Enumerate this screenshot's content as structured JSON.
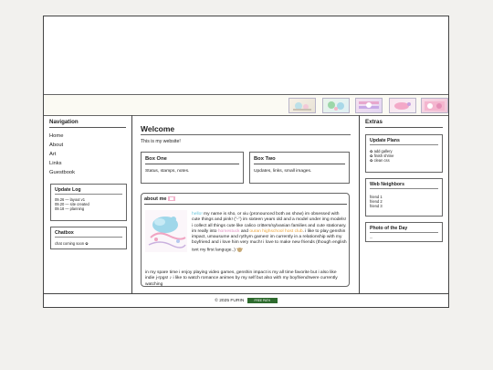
{
  "nav": {
    "title": "Navigation",
    "items": [
      "Home",
      "About",
      "Art",
      "Links",
      "Guestbook"
    ]
  },
  "update_log": {
    "title": "Update Log",
    "entries": [
      "09.26 — layout v1",
      "09.20 — site created",
      "09.18 — planning"
    ]
  },
  "chatbox": {
    "title": "Chatbox",
    "text": "chat coming soon ✿"
  },
  "main": {
    "title": "Welcome",
    "intro": "This is my website!",
    "box_one": {
      "title": "Box One",
      "body": "Status, stamps, notes."
    },
    "box_two": {
      "title": "Box Two",
      "body": "Updates, links, small images."
    }
  },
  "about": {
    "title": "about me",
    "hello": "hello!",
    "p1": " my name is sho, or xiu (pronounced both as show) im obsessed with cute things and pink! (˘ᵕ˘) im sixteen years old and a model under img models! i collect all things cute like calico critters/sylvanian families and cute stationary. im really into ",
    "tag1": "homestuck",
    "mid1": " and ",
    "tag2": "ouran highschool host club",
    "p1b": ". i like to play genshin impact, umausume and rythym games! im currently in a relationship with my boyfriend and i love him very much! i love to make new friends (though english isnt my first languge..)",
    "p2": "in my spare time i enjoy playing video games, genshin impact is my all time favorite but i also like indie j-rpgs! ♪ i like to watch romance animes by my self but also with my boyfriend!were currently watching"
  },
  "extras": {
    "title": "Extras",
    "update_plans": {
      "title": "Update Plans",
      "items": [
        "add gallery",
        "finish shrine",
        "clean css"
      ]
    },
    "web_neighbors": {
      "title": "Web Neighbors",
      "items": [
        "friend 1",
        "friend 2",
        "friend 3"
      ]
    },
    "photo": {
      "title": "Photo of the Day",
      "caption": "..."
    }
  },
  "footer": {
    "text": "© 2025 FURIN",
    "badge": "FREE PATH"
  },
  "colors": {
    "accent_blue": "#67c4d9",
    "accent_pink": "#e08fc0",
    "accent_orange": "#e8a23a"
  }
}
